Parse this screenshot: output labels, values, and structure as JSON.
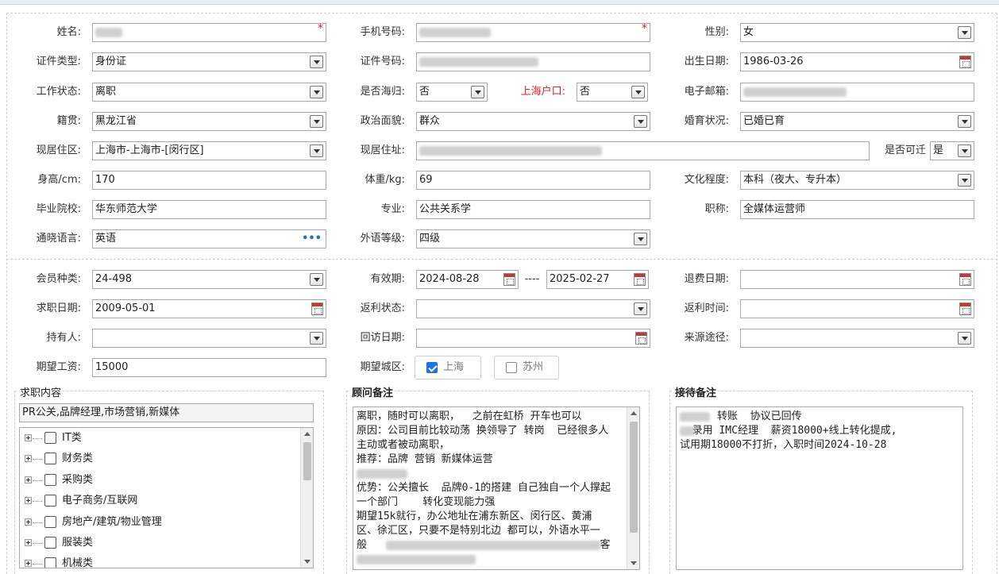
{
  "basic": {
    "name": {
      "label": "姓名:",
      "value": ""
    },
    "phone": {
      "label": "手机号码:",
      "value": ""
    },
    "gender": {
      "label": "性别:",
      "value": "女"
    },
    "id_type": {
      "label": "证件类型:",
      "value": "身份证"
    },
    "id_number": {
      "label": "证件号码:",
      "value": ""
    },
    "birth_date": {
      "label": "出生日期:",
      "value": "1986-03-26"
    },
    "work_status": {
      "label": "工作状态:",
      "value": "离职"
    },
    "returnee": {
      "label": "是否海归:",
      "value": "否"
    },
    "shanghai_hukou": {
      "label": "上海户口:",
      "value": "否"
    },
    "email": {
      "label": "电子邮箱:",
      "value": ""
    },
    "native_place": {
      "label": "籍贯:",
      "value": "黑龙江省"
    },
    "political_status": {
      "label": "政治面貌:",
      "value": "群众"
    },
    "marital_status": {
      "label": "婚育状况:",
      "value": "已婚已育"
    },
    "residence_area": {
      "label": "现居住区:",
      "value": "上海市-上海市-[闵行区]"
    },
    "residence_address": {
      "label": "现居住址:",
      "value": ""
    },
    "relocatable": {
      "label": "是否可迁",
      "value": "是"
    },
    "height": {
      "label": "身高/cm:",
      "value": "170"
    },
    "weight": {
      "label": "体重/kg:",
      "value": "69"
    },
    "education": {
      "label": "文化程度:",
      "value": "本科（夜大、专升本）"
    },
    "school": {
      "label": "毕业院校:",
      "value": "华东师范大学"
    },
    "major": {
      "label": "专业:",
      "value": "公共关系学"
    },
    "title": {
      "label": "职称:",
      "value": "全媒体运营师"
    },
    "language": {
      "label": "通晓语言:",
      "value": "英语"
    },
    "foreign_level": {
      "label": "外语等级:",
      "value": "四级"
    }
  },
  "membership": {
    "member_type": {
      "label": "会员种类:",
      "value": "24-498"
    },
    "valid_period": {
      "label": "有效期:",
      "from": "2024-08-28",
      "sep": "----",
      "to": "2025-02-27"
    },
    "refund_date": {
      "label": "退费日期:",
      "value": ""
    },
    "job_seek_date": {
      "label": "求职日期:",
      "value": "2009-05-01"
    },
    "rebate_status": {
      "label": "返利状态:",
      "value": ""
    },
    "rebate_time": {
      "label": "返利时间:",
      "value": ""
    },
    "holder": {
      "label": "持有人:",
      "value": ""
    },
    "visit_date": {
      "label": "回访日期:",
      "value": ""
    },
    "source": {
      "label": "来源途径:",
      "value": ""
    },
    "expected_salary": {
      "label": "期望工资:",
      "value": "15000"
    },
    "expected_city": {
      "label": "期望城区:",
      "options": [
        {
          "label": "上海",
          "checked": true
        },
        {
          "label": "苏州",
          "checked": false
        }
      ]
    }
  },
  "job_content": {
    "title": "求职内容",
    "summary": "PR公关,品牌经理,市场营销,新媒体",
    "tree": [
      "IT类",
      "财务类",
      "采购类",
      "电子商务/互联网",
      "房地产/建筑/物业管理",
      "服装类",
      "机械类"
    ]
  },
  "consultant_notes": {
    "title": "顾问备注",
    "lines": [
      "离职，随时可以离职，  之前在虹桥 开车也可以",
      "原因：公司目前比较动荡 换领导了 转岗  已经很多人",
      "主动或者被动离职，",
      "推荐：品牌 营销 新媒体运营",
      "",
      "优势：公关擅长  品牌0-1的搭建 自己独自一个人撑起",
      "一个部门    转化变现能力强",
      "期望15k就行，办公地址在浦东新区、闵行区、黄浦",
      "区、徐汇区，只要不是特别北边 都可以，外语水平一",
      "般",
      "客"
    ]
  },
  "reception_notes": {
    "title": "接待备注",
    "lines": [
      "      转账  协议已回传",
      "",
      "  录用 IMC经理  薪资18000+线上转化提成,",
      "试用期18000不打折，入职时间2024-10-28"
    ]
  }
}
